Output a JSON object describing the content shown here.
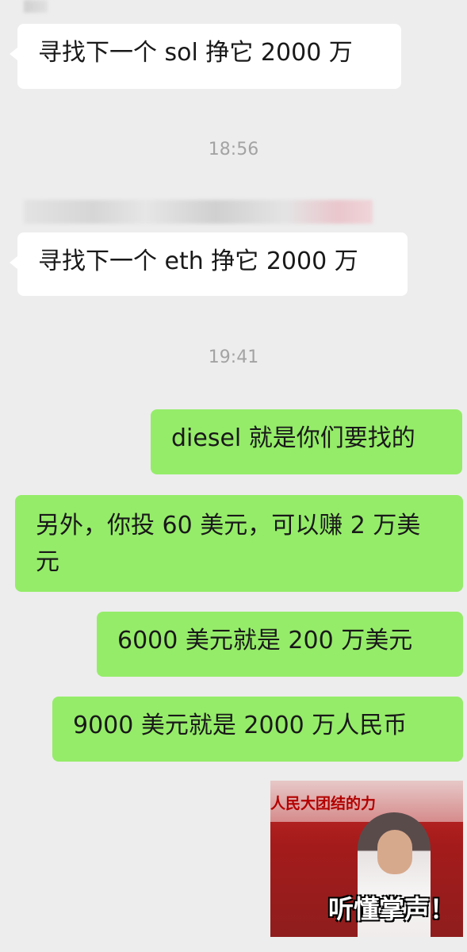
{
  "timestamps": [
    "18:56",
    "19:41"
  ],
  "messages": [
    {
      "text": "寻找下一个 sol 挣它 2000 万"
    },
    {
      "text": "寻找下一个 eth 挣它 2000 万"
    },
    {
      "text": "diesel 就是你们要找的"
    },
    {
      "text": "另外，你投 60 美元，可以赚 2 万美元"
    },
    {
      "text": "6000 美元就是 200 万美元"
    },
    {
      "text": "9000 美元就是 2000 万人民币"
    }
  ],
  "sticker": {
    "banner_text": "人民大团结的力",
    "caption": "听懂掌声！"
  },
  "colors": {
    "background": "#ededed",
    "incoming_bubble": "#ffffff",
    "outgoing_bubble": "#95ec69",
    "timestamp": "#a3a3a3"
  }
}
